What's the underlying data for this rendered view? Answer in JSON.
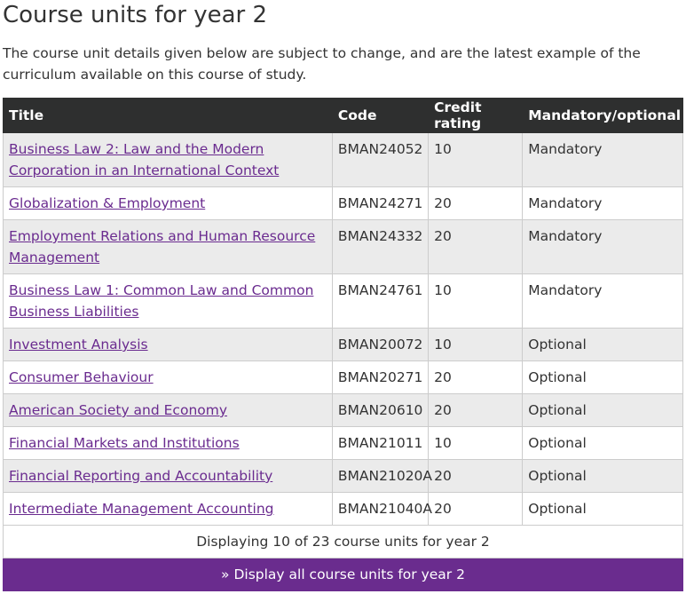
{
  "page": {
    "title": "Course units for year 2",
    "intro": "The course unit details given below are subject to change, and are the latest example of the curriculum available on this course of study."
  },
  "table": {
    "headers": {
      "title": "Title",
      "code": "Code",
      "credit": "Credit rating",
      "mandatory": "Mandatory/optional"
    },
    "rows": [
      {
        "title": "Business Law 2: Law and the Modern Corporation in an International Context",
        "code": "BMAN24052",
        "credit": "10",
        "mandatory": "Mandatory"
      },
      {
        "title": "Globalization & Employment",
        "code": "BMAN24271",
        "credit": "20",
        "mandatory": "Mandatory"
      },
      {
        "title": "Employment Relations and Human Resource Management",
        "code": "BMAN24332",
        "credit": "20",
        "mandatory": "Mandatory"
      },
      {
        "title": "Business Law 1: Common Law and Common Business Liabilities",
        "code": "BMAN24761",
        "credit": "10",
        "mandatory": "Mandatory"
      },
      {
        "title": "Investment Analysis",
        "code": "BMAN20072",
        "credit": "10",
        "mandatory": "Optional"
      },
      {
        "title": "Consumer Behaviour",
        "code": "BMAN20271",
        "credit": "20",
        "mandatory": "Optional"
      },
      {
        "title": "American Society and Economy",
        "code": "BMAN20610",
        "credit": "20",
        "mandatory": "Optional"
      },
      {
        "title": "Financial Markets and Institutions",
        "code": "BMAN21011",
        "credit": "10",
        "mandatory": "Optional"
      },
      {
        "title": "Financial Reporting and Accountability",
        "code": "BMAN21020A",
        "credit": "20",
        "mandatory": "Optional"
      },
      {
        "title": "Intermediate Management Accounting",
        "code": "BMAN21040A",
        "credit": "20",
        "mandatory": "Optional"
      }
    ],
    "summary": "Displaying 10 of 23 course units for year 2",
    "display_all": "» Display all course units for year 2"
  },
  "colors": {
    "header_bg": "#2e2f2f",
    "link": "#6a2b8f",
    "accent_button": "#6a2c8e",
    "row_alt": "#ebebeb"
  }
}
